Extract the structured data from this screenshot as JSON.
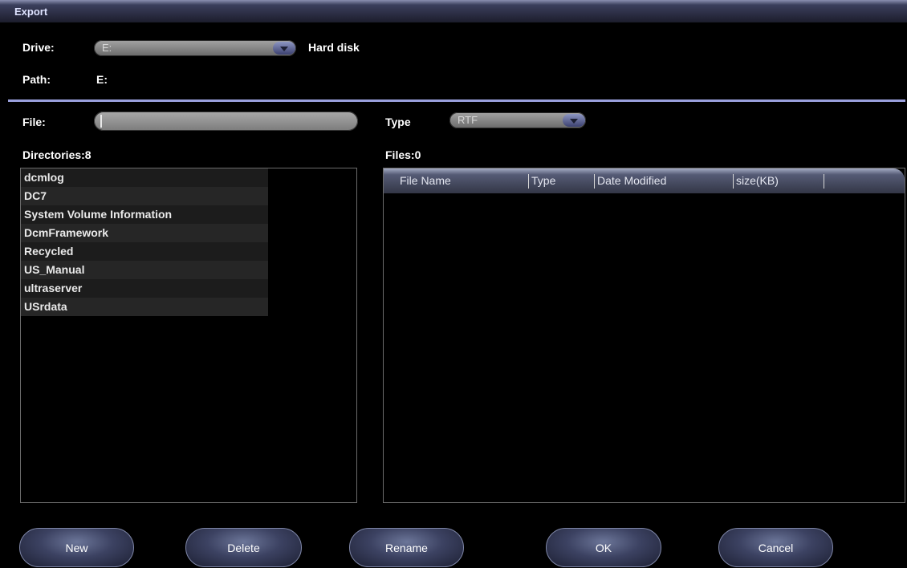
{
  "window": {
    "title": "Export"
  },
  "drive": {
    "label": "Drive:",
    "value": "E:",
    "description": "Hard disk"
  },
  "path": {
    "label": "Path:",
    "value": "E:"
  },
  "file": {
    "label": "File:",
    "value": ""
  },
  "type": {
    "label": "Type",
    "value": "RTF"
  },
  "directories": {
    "header": "Directories:8",
    "items": [
      "dcmlog",
      "DC7",
      "System Volume Information",
      "DcmFramework",
      "Recycled",
      "US_Manual",
      "ultraserver",
      "USrdata"
    ]
  },
  "files": {
    "header": "Files:0",
    "columns": [
      "File Name",
      "Type",
      "Date Modified",
      "size(KB)"
    ],
    "rows": []
  },
  "buttons": {
    "new": "New",
    "delete": "Delete",
    "rename": "Rename",
    "ok": "OK",
    "cancel": "Cancel"
  },
  "colors": {
    "background": "#000000",
    "accent": "#9aa0dd",
    "button": "#3c4262"
  }
}
